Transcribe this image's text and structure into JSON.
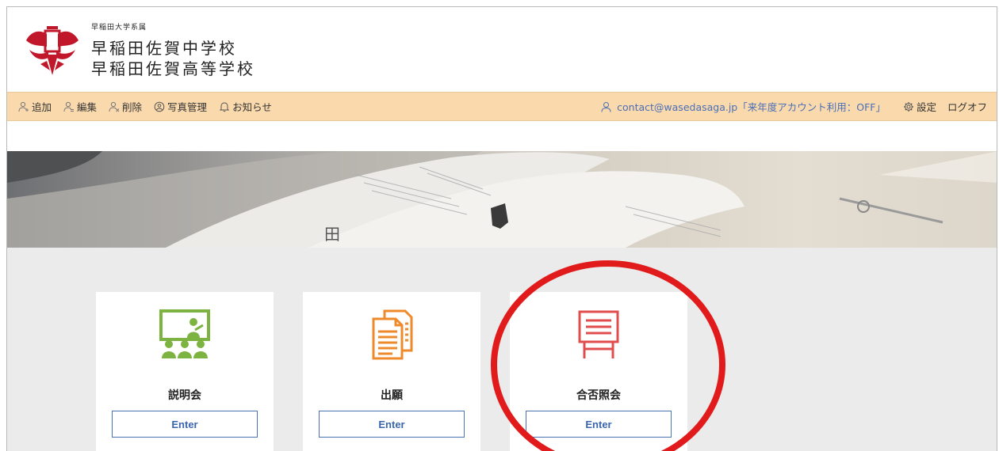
{
  "brand": {
    "sub": "早稲田大学系属",
    "line1": "早稲田佐賀中学校",
    "line2": "早稲田佐賀高等学校"
  },
  "toolbar": {
    "left": [
      {
        "label": "追加",
        "icon": "add-user-icon"
      },
      {
        "label": "編集",
        "icon": "edit-user-icon"
      },
      {
        "label": "削除",
        "icon": "delete-user-icon"
      },
      {
        "label": "写真管理",
        "icon": "photo-manage-icon"
      },
      {
        "label": "お知らせ",
        "icon": "bell-icon"
      }
    ],
    "account": "contact@wasedasaga.jp「来年度アカウント利用：OFF」",
    "settings": "設定",
    "logoff": "ログオフ"
  },
  "cards": [
    {
      "title": "説明会",
      "button": "Enter",
      "icon": "presentation-icon",
      "color": "#7cb341"
    },
    {
      "title": "出願",
      "button": "Enter",
      "icon": "documents-icon",
      "color": "#ef8a2b"
    },
    {
      "title": "合否照会",
      "button": "Enter",
      "icon": "notice-board-icon",
      "color": "#e14d4d"
    }
  ],
  "colors": {
    "toolbar_bg": "#fad9ac",
    "account_text": "#4a6fb8",
    "button_border": "#4a72b0",
    "highlight": "#e11b1b"
  }
}
